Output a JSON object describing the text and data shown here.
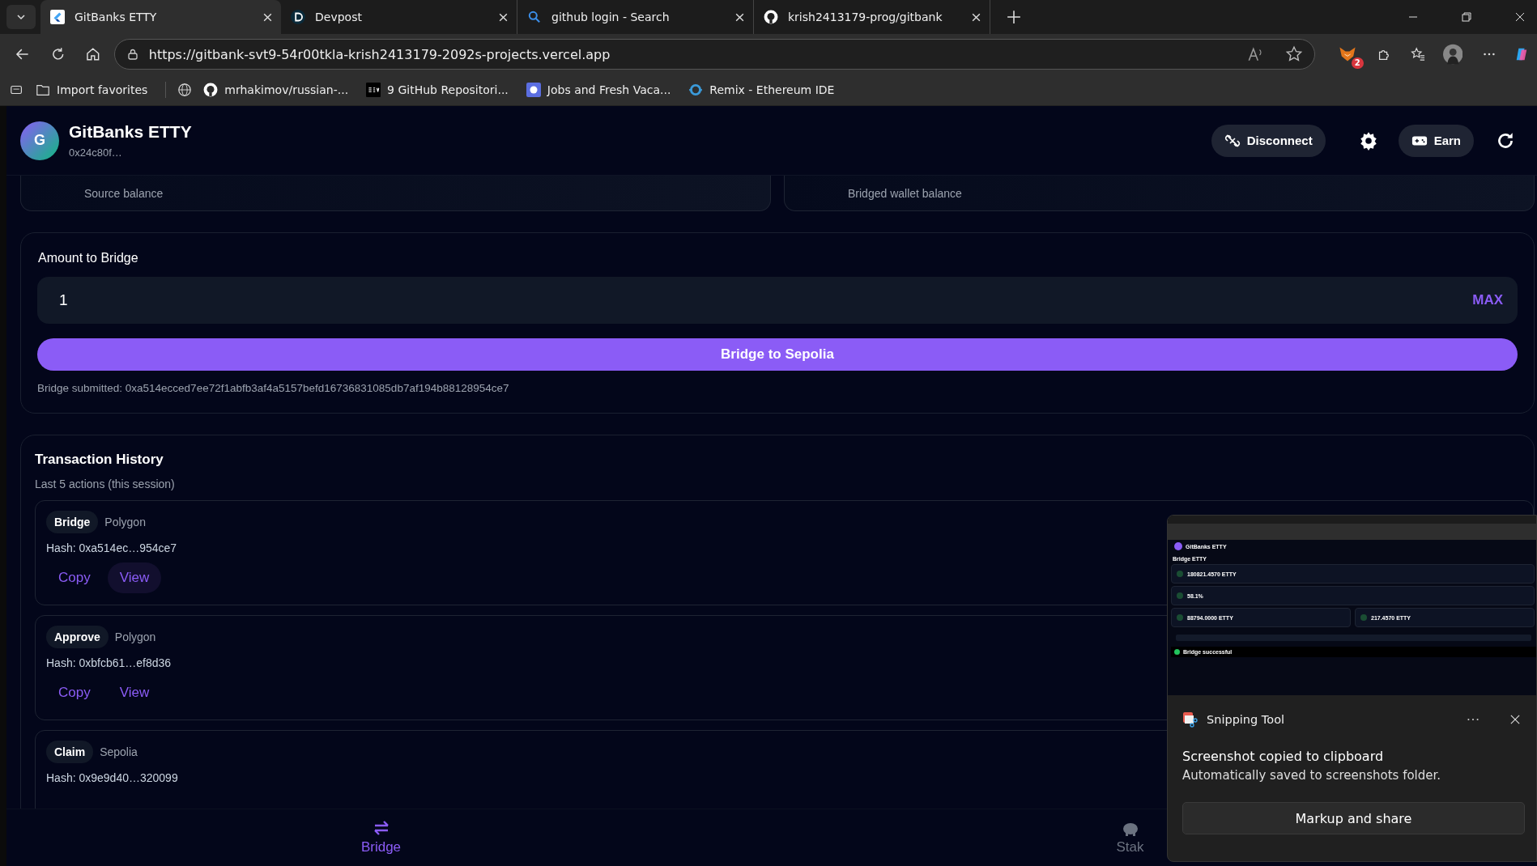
{
  "browser": {
    "tabs": [
      {
        "title": "GitBanks ETTY",
        "kind": "app",
        "selected": true
      },
      {
        "title": "Devpost",
        "kind": "devpost",
        "selected": false
      },
      {
        "title": "github login - Search",
        "kind": "search",
        "selected": false
      },
      {
        "title": "krish2413179-prog/gitbank",
        "kind": "github",
        "selected": false
      }
    ],
    "url": "https://gitbank-svt9-54r00tkla-krish2413179-2092s-projects.vercel.app",
    "extension_badge": "2",
    "bookmarks": [
      {
        "label": "Import favorites",
        "kind": "folder"
      },
      {
        "label": "mrhakimov/russian-...",
        "kind": "github"
      },
      {
        "label": "9 GitHub Repositori...",
        "kind": "dev"
      },
      {
        "label": "Jobs and Fresh Vaca...",
        "kind": "jobs"
      },
      {
        "label": "Remix - Ethereum IDE",
        "kind": "remix"
      }
    ]
  },
  "app": {
    "logo_letter": "G",
    "title": "GitBanks ETTY",
    "address": "0x24c80f…",
    "actions": [
      {
        "kind": "disconnect",
        "label": "Disconnect"
      },
      {
        "kind": "settings"
      },
      {
        "kind": "earn",
        "label": "Earn"
      },
      {
        "kind": "refresh"
      }
    ]
  },
  "balance_cards": [
    {
      "caption": "Source balance"
    },
    {
      "caption": "Bridged wallet balance"
    }
  ],
  "bridge_form": {
    "label": "Amount to Bridge",
    "amount": "1",
    "max": "MAX",
    "submit": "Bridge to Sepolia",
    "status": "Bridge submitted: 0xa514ecced7ee72f1abfb3af4a5157befd16736831085db7af194b88128954ce7"
  },
  "history": {
    "title": "Transaction History",
    "subtitle": "Last 5 actions (this session)",
    "rows": [
      {
        "action": "Bridge",
        "network": "Polygon",
        "hash": "Hash: 0xa514ec…954ce7",
        "buttons": [
          {
            "label": "Copy",
            "hovered": false
          },
          {
            "label": "View",
            "hovered": true
          }
        ]
      },
      {
        "action": "Approve",
        "network": "Polygon",
        "hash": "Hash: 0xbfcb61…ef8d36",
        "buttons": [
          {
            "label": "Copy",
            "hovered": false
          },
          {
            "label": "View",
            "hovered": false
          }
        ]
      },
      {
        "action": "Claim",
        "network": "Sepolia",
        "hash": "Hash: 0x9e9d40…320099",
        "buttons": []
      }
    ]
  },
  "bottom_nav": [
    {
      "label": "Bridge",
      "kind": "bridge",
      "selected": true
    },
    {
      "label": "Stak",
      "kind": "stake",
      "selected": false
    }
  ],
  "notification": {
    "app": "Snipping Tool",
    "heading": "Screenshot copied to clipboard",
    "body": "Automatically saved to screenshots folder.",
    "action": "Markup and share",
    "thumbnail": {
      "title": "GitBanks ETTY",
      "heading": "Bridge ETTY",
      "stats": [
        "180821.4570 ETTY",
        "58.1%"
      ],
      "pair": [
        "88794.0000 ETTY",
        "217.4570 ETTY"
      ],
      "toast": "Bridge successful"
    }
  }
}
